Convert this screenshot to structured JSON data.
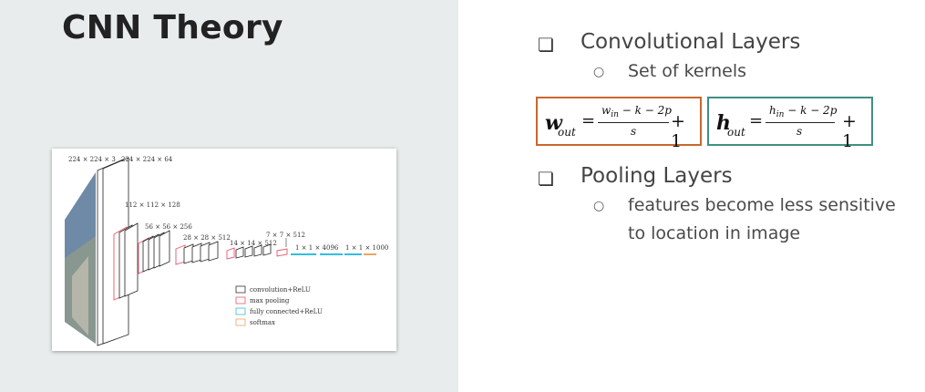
{
  "slide": {
    "title": "CNN Theory"
  },
  "figure": {
    "labels": {
      "l1": "224 × 224 × 3",
      "l2": "224 × 224 × 64",
      "l3": "112 × 112 × 128",
      "l4": "56 × 56 × 256",
      "l5": "28 × 28 × 512",
      "l6": "14 × 14 × 512",
      "l7": "7 × 7 × 512",
      "l8": "1 × 1 × 4096",
      "l9": "1 × 1 × 1000"
    },
    "legend": [
      {
        "label": "convolution+ReLU",
        "color": "#333333"
      },
      {
        "label": "max pooling",
        "color": "#e8566b"
      },
      {
        "label": "fully connected+ReLU",
        "color": "#35bde0"
      },
      {
        "label": "softmax",
        "color": "#f0a35e"
      }
    ]
  },
  "bullets": {
    "b1": {
      "text": "Convolutional Layers",
      "sub": "Set of kernels"
    },
    "b2": {
      "text": "Pooling Layers",
      "sub1": "features become less sensitive",
      "sub2": "to location in image"
    },
    "box_glyph": "❏",
    "circle_glyph": "○"
  },
  "formulas": {
    "w": {
      "var": "w",
      "sub": "out",
      "eq": "=",
      "num_var": "w",
      "num_sub": "in",
      "num_rest": " − k − 2p",
      "den": "s",
      "plus": "+ 1"
    },
    "h": {
      "var": "h",
      "sub": "out",
      "eq": "=",
      "num_var": "h",
      "num_sub": "in",
      "num_rest": " − k − 2p",
      "den": "s",
      "plus": "+ 1"
    },
    "colors": {
      "w_border": "#c9672c",
      "h_border": "#3f8f82"
    }
  }
}
